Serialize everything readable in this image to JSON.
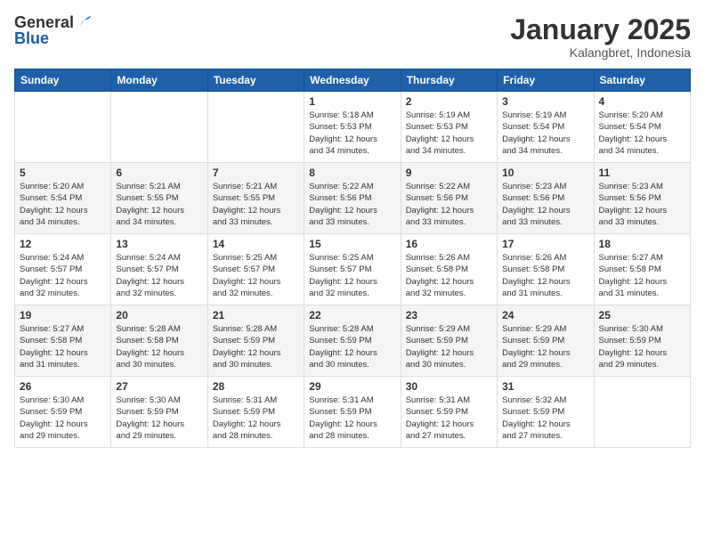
{
  "header": {
    "logo_general": "General",
    "logo_blue": "Blue",
    "month_title": "January 2025",
    "location": "Kalangbret, Indonesia"
  },
  "weekdays": [
    "Sunday",
    "Monday",
    "Tuesday",
    "Wednesday",
    "Thursday",
    "Friday",
    "Saturday"
  ],
  "weeks": [
    [
      {
        "day": "",
        "info": ""
      },
      {
        "day": "",
        "info": ""
      },
      {
        "day": "",
        "info": ""
      },
      {
        "day": "1",
        "info": "Sunrise: 5:18 AM\nSunset: 5:53 PM\nDaylight: 12 hours\nand 34 minutes."
      },
      {
        "day": "2",
        "info": "Sunrise: 5:19 AM\nSunset: 5:53 PM\nDaylight: 12 hours\nand 34 minutes."
      },
      {
        "day": "3",
        "info": "Sunrise: 5:19 AM\nSunset: 5:54 PM\nDaylight: 12 hours\nand 34 minutes."
      },
      {
        "day": "4",
        "info": "Sunrise: 5:20 AM\nSunset: 5:54 PM\nDaylight: 12 hours\nand 34 minutes."
      }
    ],
    [
      {
        "day": "5",
        "info": "Sunrise: 5:20 AM\nSunset: 5:54 PM\nDaylight: 12 hours\nand 34 minutes."
      },
      {
        "day": "6",
        "info": "Sunrise: 5:21 AM\nSunset: 5:55 PM\nDaylight: 12 hours\nand 34 minutes."
      },
      {
        "day": "7",
        "info": "Sunrise: 5:21 AM\nSunset: 5:55 PM\nDaylight: 12 hours\nand 33 minutes."
      },
      {
        "day": "8",
        "info": "Sunrise: 5:22 AM\nSunset: 5:56 PM\nDaylight: 12 hours\nand 33 minutes."
      },
      {
        "day": "9",
        "info": "Sunrise: 5:22 AM\nSunset: 5:56 PM\nDaylight: 12 hours\nand 33 minutes."
      },
      {
        "day": "10",
        "info": "Sunrise: 5:23 AM\nSunset: 5:56 PM\nDaylight: 12 hours\nand 33 minutes."
      },
      {
        "day": "11",
        "info": "Sunrise: 5:23 AM\nSunset: 5:56 PM\nDaylight: 12 hours\nand 33 minutes."
      }
    ],
    [
      {
        "day": "12",
        "info": "Sunrise: 5:24 AM\nSunset: 5:57 PM\nDaylight: 12 hours\nand 32 minutes."
      },
      {
        "day": "13",
        "info": "Sunrise: 5:24 AM\nSunset: 5:57 PM\nDaylight: 12 hours\nand 32 minutes."
      },
      {
        "day": "14",
        "info": "Sunrise: 5:25 AM\nSunset: 5:57 PM\nDaylight: 12 hours\nand 32 minutes."
      },
      {
        "day": "15",
        "info": "Sunrise: 5:25 AM\nSunset: 5:57 PM\nDaylight: 12 hours\nand 32 minutes."
      },
      {
        "day": "16",
        "info": "Sunrise: 5:26 AM\nSunset: 5:58 PM\nDaylight: 12 hours\nand 32 minutes."
      },
      {
        "day": "17",
        "info": "Sunrise: 5:26 AM\nSunset: 5:58 PM\nDaylight: 12 hours\nand 31 minutes."
      },
      {
        "day": "18",
        "info": "Sunrise: 5:27 AM\nSunset: 5:58 PM\nDaylight: 12 hours\nand 31 minutes."
      }
    ],
    [
      {
        "day": "19",
        "info": "Sunrise: 5:27 AM\nSunset: 5:58 PM\nDaylight: 12 hours\nand 31 minutes."
      },
      {
        "day": "20",
        "info": "Sunrise: 5:28 AM\nSunset: 5:58 PM\nDaylight: 12 hours\nand 30 minutes."
      },
      {
        "day": "21",
        "info": "Sunrise: 5:28 AM\nSunset: 5:59 PM\nDaylight: 12 hours\nand 30 minutes."
      },
      {
        "day": "22",
        "info": "Sunrise: 5:28 AM\nSunset: 5:59 PM\nDaylight: 12 hours\nand 30 minutes."
      },
      {
        "day": "23",
        "info": "Sunrise: 5:29 AM\nSunset: 5:59 PM\nDaylight: 12 hours\nand 30 minutes."
      },
      {
        "day": "24",
        "info": "Sunrise: 5:29 AM\nSunset: 5:59 PM\nDaylight: 12 hours\nand 29 minutes."
      },
      {
        "day": "25",
        "info": "Sunrise: 5:30 AM\nSunset: 5:59 PM\nDaylight: 12 hours\nand 29 minutes."
      }
    ],
    [
      {
        "day": "26",
        "info": "Sunrise: 5:30 AM\nSunset: 5:59 PM\nDaylight: 12 hours\nand 29 minutes."
      },
      {
        "day": "27",
        "info": "Sunrise: 5:30 AM\nSunset: 5:59 PM\nDaylight: 12 hours\nand 29 minutes."
      },
      {
        "day": "28",
        "info": "Sunrise: 5:31 AM\nSunset: 5:59 PM\nDaylight: 12 hours\nand 28 minutes."
      },
      {
        "day": "29",
        "info": "Sunrise: 5:31 AM\nSunset: 5:59 PM\nDaylight: 12 hours\nand 28 minutes."
      },
      {
        "day": "30",
        "info": "Sunrise: 5:31 AM\nSunset: 5:59 PM\nDaylight: 12 hours\nand 27 minutes."
      },
      {
        "day": "31",
        "info": "Sunrise: 5:32 AM\nSunset: 5:59 PM\nDaylight: 12 hours\nand 27 minutes."
      },
      {
        "day": "",
        "info": ""
      }
    ]
  ]
}
